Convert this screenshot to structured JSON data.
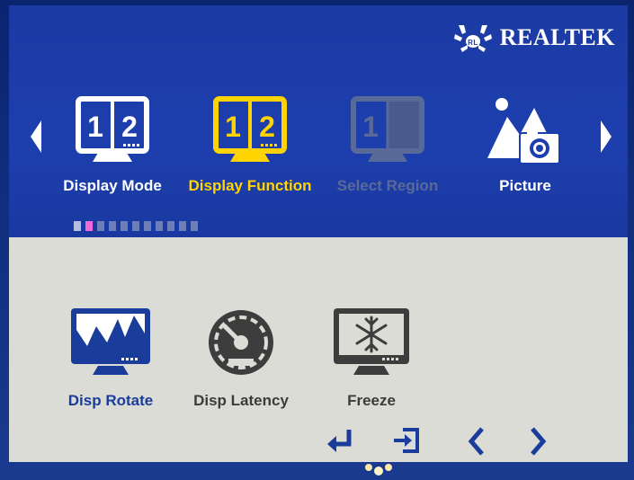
{
  "brand": {
    "name": "REALTEK"
  },
  "colors": {
    "panel_blue": "#1d3fae",
    "highlight_yellow": "#ffd400",
    "active_dot": "#f06ad8",
    "bottom_bg": "#dcdcd6",
    "selected_text": "#1a3c9a"
  },
  "top_menu": {
    "items": [
      {
        "label": "Display Mode",
        "icon": "monitor-1-2-icon",
        "state": "normal"
      },
      {
        "label": "Display Function",
        "icon": "monitor-1-2-icon",
        "state": "selected"
      },
      {
        "label": "Select Region",
        "icon": "monitor-split-icon",
        "state": "disabled"
      },
      {
        "label": "Picture",
        "icon": "picture-icon",
        "state": "normal"
      }
    ],
    "page_dots": 11,
    "active_dot_index": 1
  },
  "sub_menu": {
    "items": [
      {
        "label": "Disp Rotate",
        "icon": "chart-monitor-icon",
        "state": "selected"
      },
      {
        "label": "Disp Latency",
        "icon": "gauge-icon",
        "state": "normal"
      },
      {
        "label": "Freeze",
        "icon": "snowflake-monitor-icon",
        "state": "normal"
      }
    ]
  },
  "nav_buttons": [
    {
      "name": "enter",
      "icon": "enter-arrow-icon"
    },
    {
      "name": "exit",
      "icon": "exit-icon"
    },
    {
      "name": "left",
      "icon": "chevron-left-icon"
    },
    {
      "name": "right",
      "icon": "chevron-right-icon"
    }
  ]
}
